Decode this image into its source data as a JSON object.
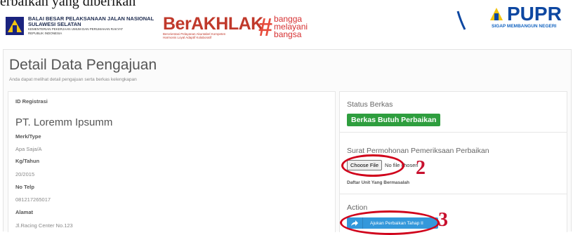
{
  "doc_line": "erbaikan yang diberikan",
  "header": {
    "institution": {
      "line1": "BALAI BESAR PELAKSANAAN JALAN NASIONAL",
      "line2": "SULAWESI SELATAN",
      "line3": "KEMENTERIAN PEKERJAAN UMUM DAN PERUMAHAN RAKYAT",
      "line4": "REPUBLIK INDONESIA"
    },
    "berakhlak": {
      "word": "BerAKHLAK",
      "sub1": "Berorientasi Pelayanan Akuntabel Kompeten",
      "sub2": "Harmonis Loyal Adaptif Kolaboratif"
    },
    "bangga": {
      "hash": "#",
      "line1": "bangga",
      "line2": "melayani",
      "line3": "bangsa"
    },
    "pupr": {
      "word": "PUPR",
      "sub": "SIGAP MEMBANGUN NEGERI"
    }
  },
  "page": {
    "title": "Detail Data Pengajuan",
    "subtitle": "Anda dapat melihat detail pengajuan serta berkas kelengkapan"
  },
  "details": {
    "id_label": "ID Registrasi",
    "company": "PT. Loremm Ipsumm",
    "merk_label": "Merk/Type",
    "merk_value": "Apa Saja/A",
    "kg_label": "Kg/Tahun",
    "kg_value": "20/2015",
    "telp_label": "No Telp",
    "telp_value": "081217265017",
    "alamat_label": "Alamat",
    "alamat_value": "Jl.Racing Center No.123"
  },
  "status": {
    "heading": "Status Berkas",
    "badge": "Berkas Butuh Perbaikan",
    "badge_color": "#2e9e3e"
  },
  "upload": {
    "heading": "Surat Permohonan Pemeriksaan Perbaikan",
    "button": "Choose File",
    "no_file": "No file chosen",
    "units_label": "Daftar Unit Yang Bermasalah"
  },
  "action": {
    "heading": "Action",
    "submit": "Ajukan Perbaikan Tahap II",
    "submit_icon": "share-arrow-icon",
    "submit_color": "#3498db"
  },
  "annotations": {
    "step2": "2",
    "step3": "3",
    "color": "#d0021b"
  }
}
